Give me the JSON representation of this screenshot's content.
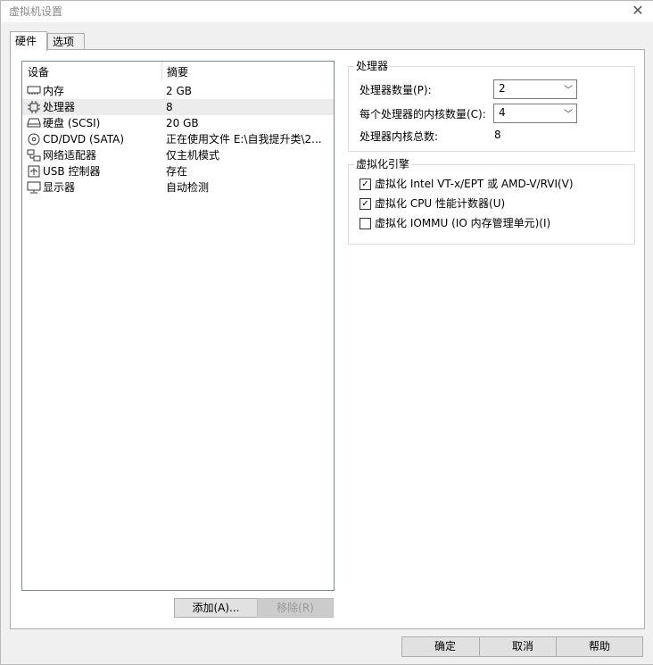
{
  "window": {
    "title": "虚拟机设置"
  },
  "tabs": [
    {
      "label": "硬件"
    },
    {
      "label": "选项"
    }
  ],
  "device_list": {
    "headers": {
      "device": "设备",
      "summary": "摘要"
    },
    "rows": [
      {
        "icon": "memory-icon",
        "name": "内存",
        "summary": "2 GB"
      },
      {
        "icon": "cpu-icon",
        "name": "处理器",
        "summary": "8"
      },
      {
        "icon": "disk-icon",
        "name": "硬盘 (SCSI)",
        "summary": "20 GB"
      },
      {
        "icon": "cd-icon",
        "name": "CD/DVD (SATA)",
        "summary": "正在使用文件 E:\\自我提升类\\2..."
      },
      {
        "icon": "network-icon",
        "name": "网络适配器",
        "summary": "仅主机模式"
      },
      {
        "icon": "usb-icon",
        "name": "USB 控制器",
        "summary": "存在"
      },
      {
        "icon": "display-icon",
        "name": "显示器",
        "summary": "自动检测"
      }
    ]
  },
  "list_buttons": {
    "add": "添加(A)...",
    "remove": "移除(R)"
  },
  "processor": {
    "title": "处理器",
    "count_label": "处理器数量(P):",
    "count_value": "2",
    "cores_label": "每个处理器的内核数量(C):",
    "cores_value": "4",
    "total_label": "处理器内核总数:",
    "total_value": "8"
  },
  "virtualization": {
    "title": "虚拟化引擎",
    "options": [
      {
        "label": "虚拟化 Intel VT-x/EPT 或 AMD-V/RVI(V)",
        "checked": true
      },
      {
        "label": "虚拟化 CPU 性能计数器(U)",
        "checked": true
      },
      {
        "label": "虚拟化 IOMMU (IO 内存管理单元)(I)",
        "checked": false
      }
    ]
  },
  "footer": {
    "ok": "确定",
    "cancel": "取消",
    "help": "帮助"
  }
}
